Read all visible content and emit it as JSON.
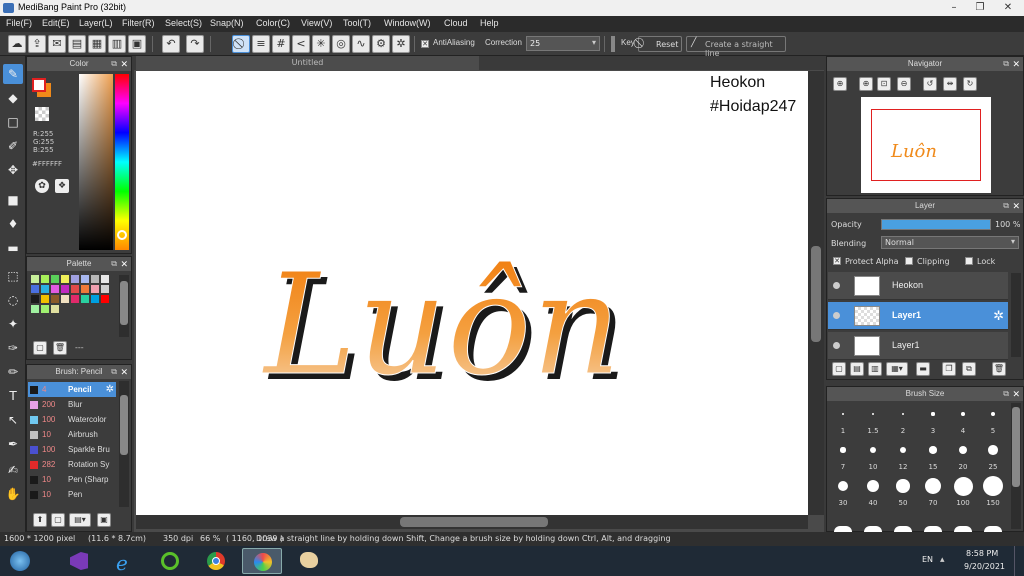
{
  "title": "MediBang Paint Pro (32bit)",
  "menu": [
    "File(F)",
    "Edit(E)",
    "Layer(L)",
    "Filter(R)",
    "Select(S)",
    "Snap(N)",
    "Color(C)",
    "View(V)",
    "Tool(T)",
    "Window(W)",
    "Cloud",
    "Help"
  ],
  "toolbar": {
    "antialiasing": "AntiAliasing",
    "correction": "Correction",
    "correction_value": "25",
    "key": "Key",
    "reset": "Reset",
    "straight_line": "Create a straight line"
  },
  "color_panel": {
    "title": "Color",
    "r": "R:255",
    "g": "G:255",
    "b": "B:255",
    "hex": "#FFFFFF"
  },
  "palette_panel": {
    "title": "Palette",
    "footer": "---",
    "swatches": [
      "#c8f09a",
      "#a8f05a",
      "#5ad05a",
      "#f0f05a",
      "#a0a0e0",
      "#a8b8f0",
      "#b8b8b8",
      "#e8e8e8",
      "#4a70e0",
      "#2ab0e0",
      "#e05ae0",
      "#c02ac0",
      "#e04a4a",
      "#f07a3a",
      "#f0a0b0",
      "#d0d0d0",
      "#1a1a1a",
      "#f0c000",
      "#8a5a2a",
      "#f0e0c0",
      "#e02a6a",
      "#2ad0a0",
      "#00a0e0",
      "#ff0000",
      "#a0f0a0",
      "#a0f070",
      "#e0e0a0"
    ]
  },
  "brush_panel": {
    "title": "Brush: Pencil",
    "items": [
      {
        "size": "4",
        "name": "Pencil",
        "color": "#1a1a1a"
      },
      {
        "size": "200",
        "name": "Blur",
        "color": "#e8a0e8"
      },
      {
        "size": "100",
        "name": "Watercolor",
        "color": "#70c8f0"
      },
      {
        "size": "10",
        "name": "Airbrush",
        "color": "#c0c0c0"
      },
      {
        "size": "100",
        "name": "Sparkle Bru",
        "color": "#4a50d0"
      },
      {
        "size": "282",
        "name": "Rotation Sy",
        "color": "#e02a2a"
      },
      {
        "size": "10",
        "name": "Pen (Sharp",
        "color": "#1a1a1a"
      },
      {
        "size": "10",
        "name": "Pen",
        "color": "#1a1a1a"
      }
    ]
  },
  "canvas": {
    "tab": "Untitled",
    "watermark_line1": "Heokon",
    "watermark_line2": "#Hoidap247",
    "artwork_text": "Luôn"
  },
  "navigator": {
    "title": "Navigator"
  },
  "layer_panel": {
    "title": "Layer",
    "opacity_label": "Opacity",
    "opacity_value": "100 %",
    "opacity_fraction": 1.0,
    "blending_label": "Blending",
    "blending_value": "Normal",
    "protect_alpha": "Protect Alpha",
    "clipping": "Clipping",
    "lock": "Lock",
    "layers": [
      {
        "name": "Heokon"
      },
      {
        "name": "Layer1"
      },
      {
        "name": "Layer1"
      }
    ]
  },
  "brush_size": {
    "title": "Brush Size",
    "sizes": [
      "1",
      "1.5",
      "2",
      "3",
      "4",
      "5",
      "7",
      "10",
      "12",
      "15",
      "20",
      "25",
      "30",
      "40",
      "50",
      "70",
      "100",
      "150"
    ]
  },
  "status": {
    "size": "1600 * 1200 pixel",
    "cm": "(11.6 * 8.7cm)",
    "dpi": "350 dpi",
    "zoom": "66 %",
    "coords": "( 1160, 1039 )",
    "hint": "Draw a straight line by holding down Shift, Change a brush size by holding down Ctrl, Alt, and dragging"
  },
  "taskbar": {
    "lang": "EN",
    "time": "8:58 PM",
    "date": "9/20/2021"
  },
  "colors": {
    "accent": "#4a90d9",
    "orange": "#f08a1a"
  }
}
